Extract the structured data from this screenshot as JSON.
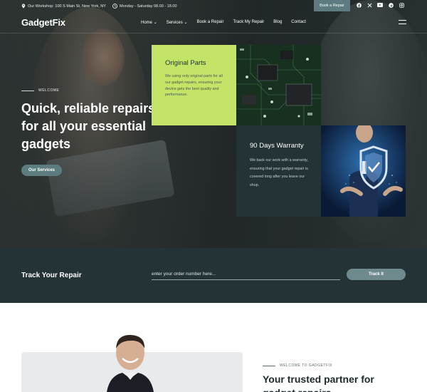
{
  "topbar": {
    "address": "Our Workshop: 100 S Main St, New York, NY",
    "hours": "Monday - Saturday 08.00 - 18.00",
    "book_button": "Book a Repair",
    "socials": [
      "facebook-icon",
      "x-icon",
      "youtube-icon",
      "pinterest-icon",
      "instagram-icon"
    ]
  },
  "nav": {
    "logo": "GadgetFix",
    "items": [
      "Home",
      "Services",
      "Book a Repair",
      "Track My Repair",
      "Blog",
      "Contact"
    ]
  },
  "hero": {
    "eyebrow": "WELCOME",
    "title": "Quick, reliable repairs for all your essential gadgets",
    "button": "Our Services"
  },
  "features": {
    "original_parts": {
      "title": "Original Parts",
      "text": "We using only original parts for all our gadget repairs, ensuring your device gets the best quality and performance."
    },
    "warranty": {
      "title": "90 Days Warranty",
      "text": "We back our work with a warranty, ensuring that your gadget repair is covered long after you leave our shop."
    }
  },
  "track": {
    "title": "Track Your Repair",
    "placeholder": "enter your order number here...",
    "button": "Track It"
  },
  "about": {
    "eyebrow": "WELCOME TO GADGETFIX",
    "title": "Your trusted partner for gadget repairs"
  },
  "colors": {
    "accent_green": "#c4e467",
    "dark_teal": "#243336",
    "button_teal": "#5d7c80"
  }
}
